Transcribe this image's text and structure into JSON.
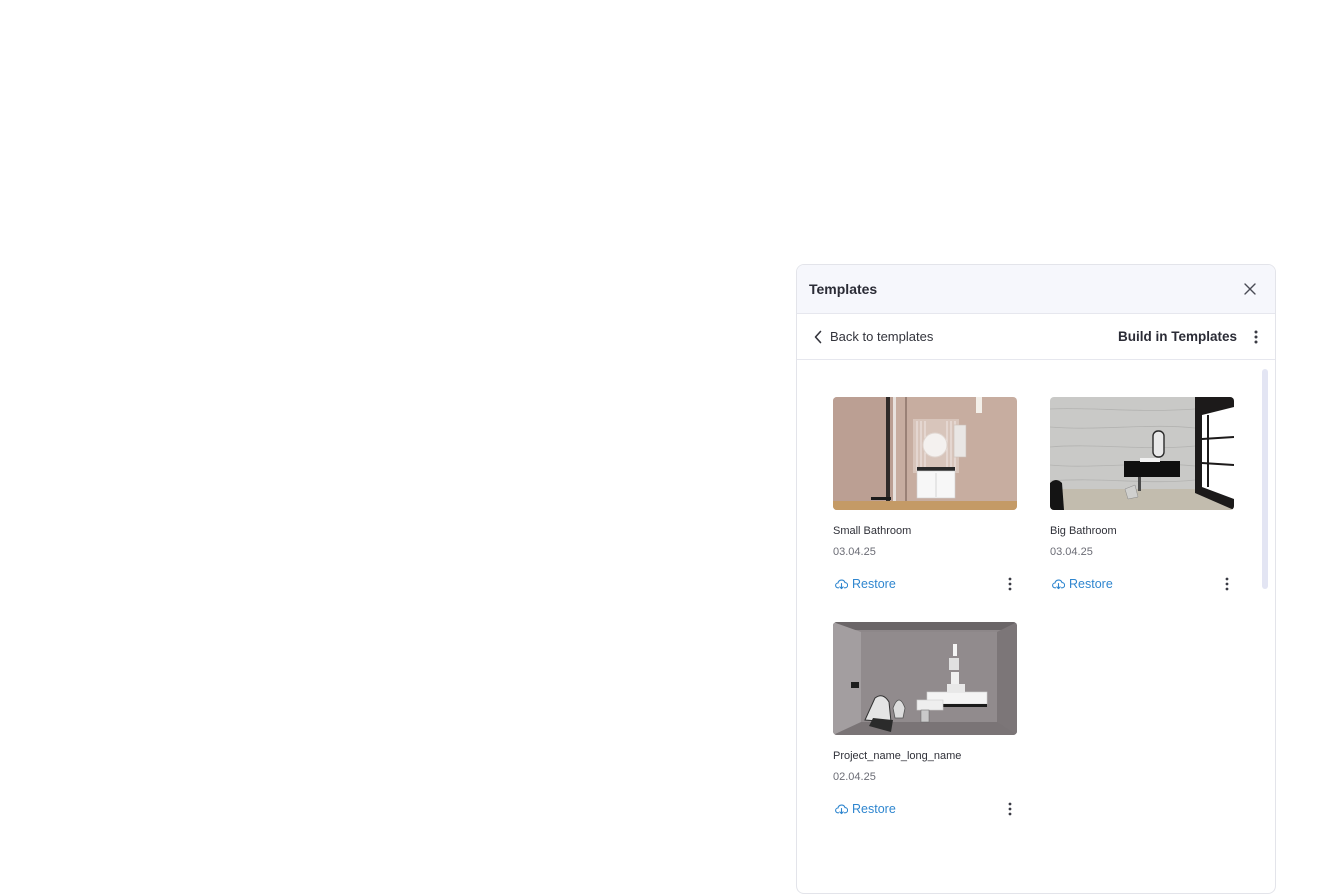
{
  "panel": {
    "title": "Templates",
    "back_label": "Back to templates",
    "section_title": "Build in Templates"
  },
  "templates": [
    {
      "name": "Small Bathroom",
      "date": "03.04.25",
      "restore_label": "Restore"
    },
    {
      "name": "Big Bathroom",
      "date": "03.04.25",
      "restore_label": "Restore"
    },
    {
      "name": "Project_name_long_name",
      "date": "02.04.25",
      "restore_label": "Restore"
    }
  ],
  "colors": {
    "accent": "#2f86cf",
    "header_bg": "#f6f7fc",
    "border": "#e3e4ea"
  },
  "icons": {
    "close": "close-icon",
    "back": "chevron-left-icon",
    "menu": "more-vertical-icon",
    "restore": "cloud-download-icon"
  }
}
